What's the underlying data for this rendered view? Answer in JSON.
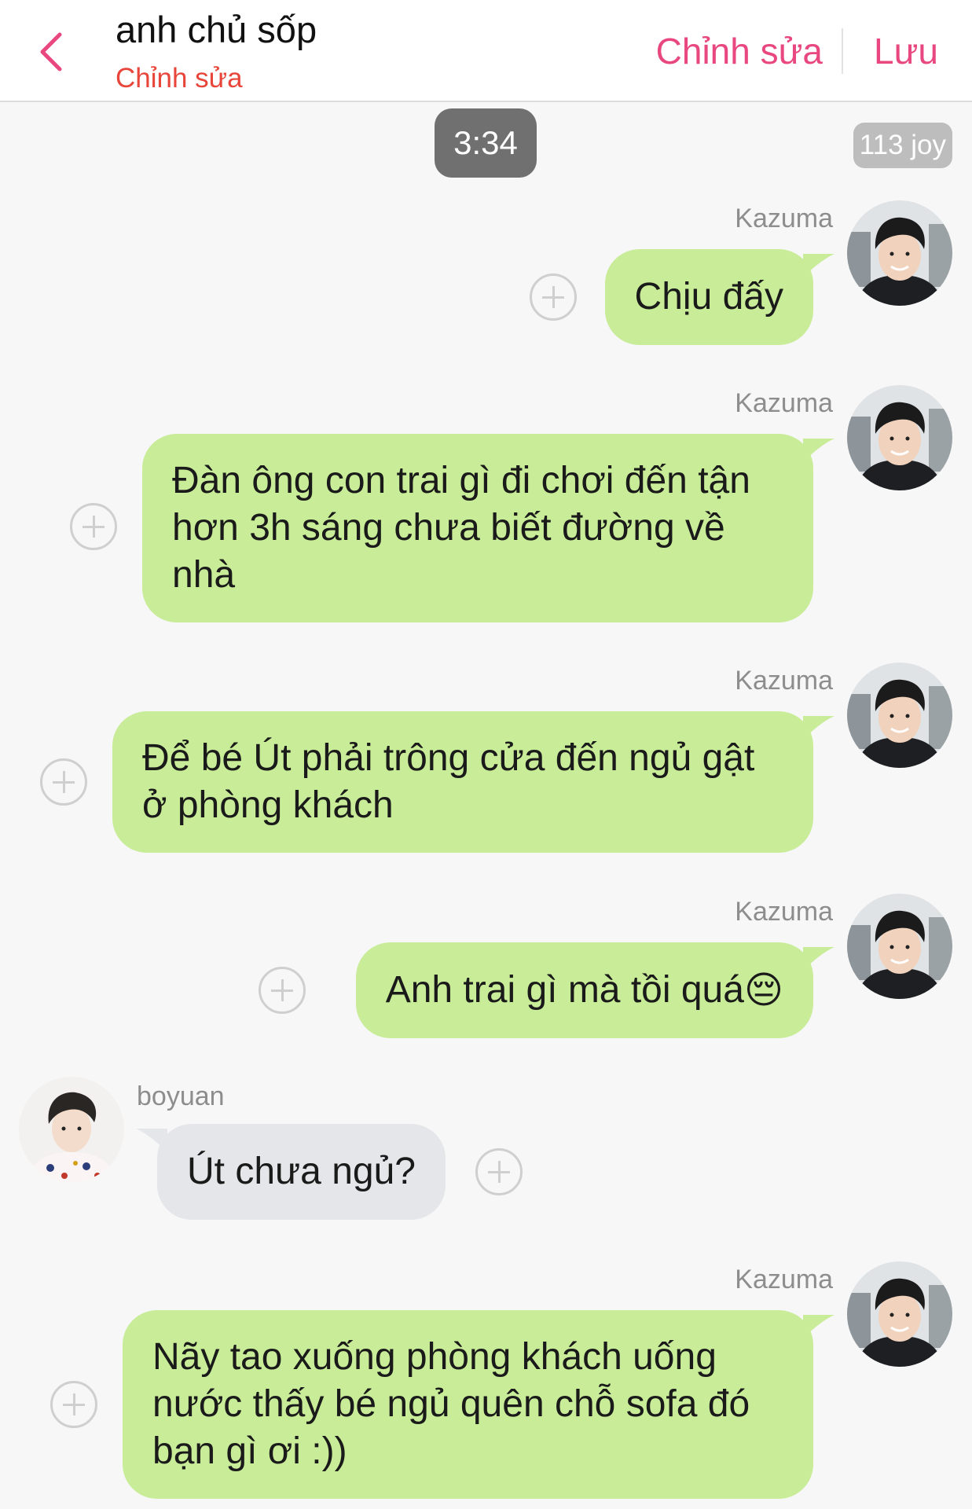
{
  "header": {
    "title": "anh chủ sốp",
    "subtitle": "Chỉnh sửa",
    "edit_label": "Chỉnh sửa",
    "save_label": "Lưu"
  },
  "timestamp": "3:34",
  "badge": "113 joy",
  "emoji": "😔",
  "messages": [
    {
      "sender": "Kazuma",
      "text": "Chịu đấy"
    },
    {
      "sender": "Kazuma",
      "text": "Đàn ông con trai gì đi chơi đến tận hơn 3h sáng chưa biết đường về nhà"
    },
    {
      "sender": "Kazuma",
      "text": "Để bé Út phải trông cửa đến ngủ gật ở phòng khách"
    },
    {
      "sender": "Kazuma",
      "text": "Anh trai gì mà tồi quá"
    },
    {
      "sender": "boyuan",
      "text": "Út chưa ngủ?"
    },
    {
      "sender": "Kazuma",
      "text": "Nãy tao xuống phòng khách uống nước thấy bé ngủ quên chỗ sofa đó bạn gì ơi :))"
    }
  ],
  "colors": {
    "accent": "#e8477f",
    "subtitle": "#e8463a",
    "sent_bubble": "#c8ec98",
    "received_bubble": "#e5e6ea"
  }
}
